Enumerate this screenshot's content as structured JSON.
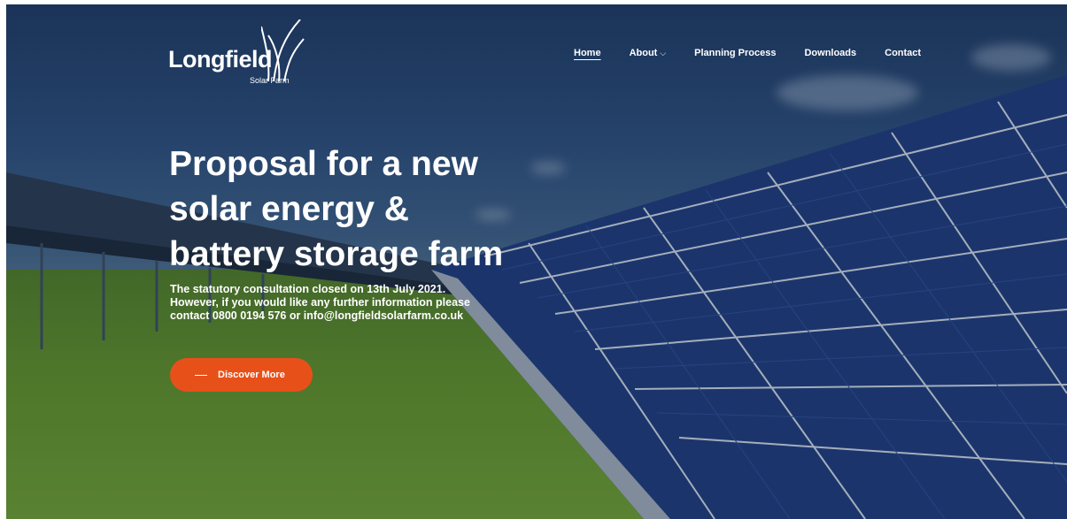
{
  "logo": {
    "word": "Longfield",
    "sub": "Solar Farm"
  },
  "nav": {
    "items": [
      {
        "label": "Home",
        "active": true
      },
      {
        "label": "About",
        "dropdown": true
      },
      {
        "label": "Planning Process"
      },
      {
        "label": "Downloads"
      },
      {
        "label": "Contact"
      }
    ]
  },
  "hero": {
    "headline": [
      "Proposal for a new",
      "solar energy &",
      "battery storage farm"
    ],
    "subtext": [
      "The statutory consultation closed on 13th July 2021.",
      "However, if you would like any further information please",
      "contact 0800 0194 576 or info@longfieldsolarfarm.co.uk"
    ],
    "cta_label": "Discover More"
  },
  "colors": {
    "accent": "#e8501a",
    "text": "#ffffff",
    "sky": "#2b4c7a",
    "grass": "#5d8c2c",
    "panel": "#1e3a78"
  }
}
